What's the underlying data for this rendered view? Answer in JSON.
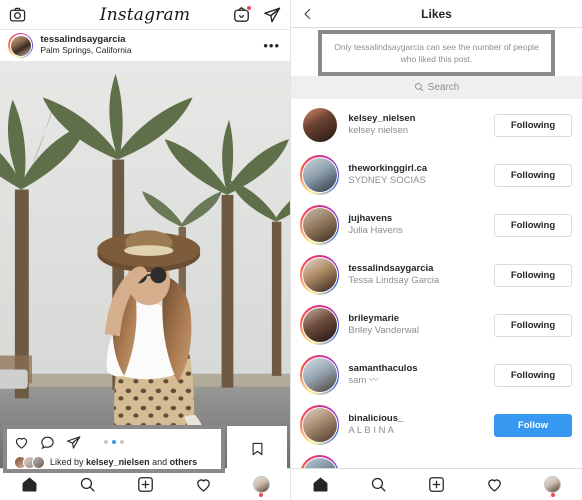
{
  "left_panel": {
    "topbar": {
      "camera_icon": "camera-icon",
      "wordmark": "Instagram",
      "igtv_icon": "igtv-icon",
      "direct_icon": "paper-plane-icon",
      "igtv_has_badge": true
    },
    "post": {
      "username": "tessalindsaygarcia",
      "location": "Palm Springs, California",
      "more_label": "•••",
      "actions": {
        "like_icon": "heart-icon",
        "comment_icon": "comment-bubble-icon",
        "share_icon": "paper-plane-icon",
        "save_icon": "bookmark-icon"
      },
      "carousel": {
        "count": 3,
        "active_index": 1,
        "active_color": "#3897f0",
        "inactive_color": "#c7c7c7"
      },
      "likes_prefix": "Liked by ",
      "likes_user": "kelsey_nielsen",
      "likes_mid": " and ",
      "likes_suffix": "others"
    },
    "bottom_nav": {
      "items": [
        {
          "name": "home",
          "icon": "home-icon",
          "active": true
        },
        {
          "name": "search",
          "icon": "search-icon",
          "active": false
        },
        {
          "name": "new-post",
          "icon": "plus-square-icon",
          "active": false
        },
        {
          "name": "activity",
          "icon": "heart-icon",
          "active": false
        },
        {
          "name": "profile",
          "icon": "avatar-icon",
          "active": false,
          "badge": true
        }
      ]
    }
  },
  "right_panel": {
    "header": {
      "back_icon": "chevron-left-icon",
      "title": "Likes"
    },
    "notice": {
      "text": "Only tessalindsaygarcia can see the number of people who liked this post.",
      "border_color": "#8a8a8a"
    },
    "search": {
      "icon": "search-icon",
      "placeholder": "Search"
    },
    "buttons": {
      "following_label": "Following",
      "follow_label": "Follow",
      "follow_color": "#3897f0"
    },
    "users": [
      {
        "username": "kelsey_nielsen",
        "fullname": "kelsey nielsen",
        "button": "Following",
        "button_type": "following",
        "ring": false
      },
      {
        "username": "theworkinggirl.ca",
        "fullname": "SYDNEY SOCIAS",
        "button": "Following",
        "button_type": "following",
        "ring": true
      },
      {
        "username": "jujhavens",
        "fullname": "Julia Havens",
        "button": "Following",
        "button_type": "following",
        "ring": true
      },
      {
        "username": "tessalindsaygarcia",
        "fullname": "Tessa Lindsay Garcia",
        "button": "Following",
        "button_type": "following",
        "ring": true
      },
      {
        "username": "brileymarie",
        "fullname": "Briley Vanderwal",
        "button": "Following",
        "button_type": "following",
        "ring": true
      },
      {
        "username": "samanthaculos",
        "fullname": "sam 〰",
        "button": "Following",
        "button_type": "following",
        "ring": true
      },
      {
        "username": "binalicious_",
        "fullname": "A L B I N A",
        "button": "Follow",
        "button_type": "follow",
        "ring": true
      }
    ],
    "bottom_nav": {
      "items": [
        {
          "name": "home",
          "icon": "home-icon",
          "active": true
        },
        {
          "name": "search",
          "icon": "search-icon",
          "active": false
        },
        {
          "name": "new-post",
          "icon": "plus-square-icon",
          "active": false
        },
        {
          "name": "activity",
          "icon": "heart-icon",
          "active": false
        },
        {
          "name": "profile",
          "icon": "avatar-icon",
          "active": false,
          "badge": true
        }
      ]
    }
  }
}
